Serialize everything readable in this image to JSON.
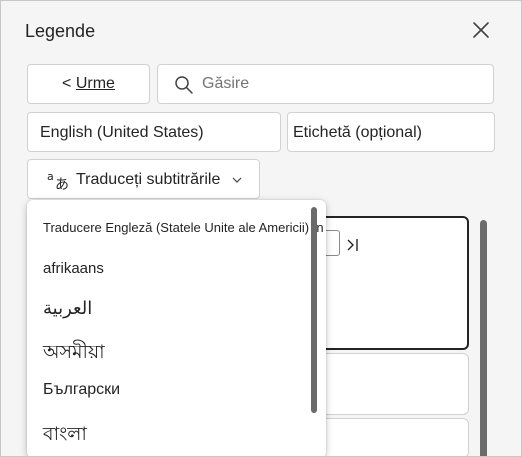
{
  "panel": {
    "title": "Legende",
    "close_icon": "close-icon"
  },
  "toolbar": {
    "prev_prefix": "<",
    "prev_label": "Urme",
    "search_placeholder": "Găsire",
    "search_icon": "search-icon"
  },
  "fields": {
    "language": "English (United States)",
    "label": "Etichetă (opțional)"
  },
  "translate": {
    "label": "Traduceți subtitrările",
    "icon": "translate-icon",
    "chevron": "chevron-down-icon"
  },
  "dropdown": {
    "header": "Traducere Engleză (Statele Unite ale Americii) în",
    "items": [
      "afrikaans",
      "العربية",
      "অসমীয়া",
      "Български",
      "বাংলা"
    ]
  },
  "colors": {
    "background": "#f5f5f5",
    "surface": "#ffffff",
    "border": "#d1d1d1",
    "text": "#242424",
    "scrollbar": "#6b6b6b"
  }
}
